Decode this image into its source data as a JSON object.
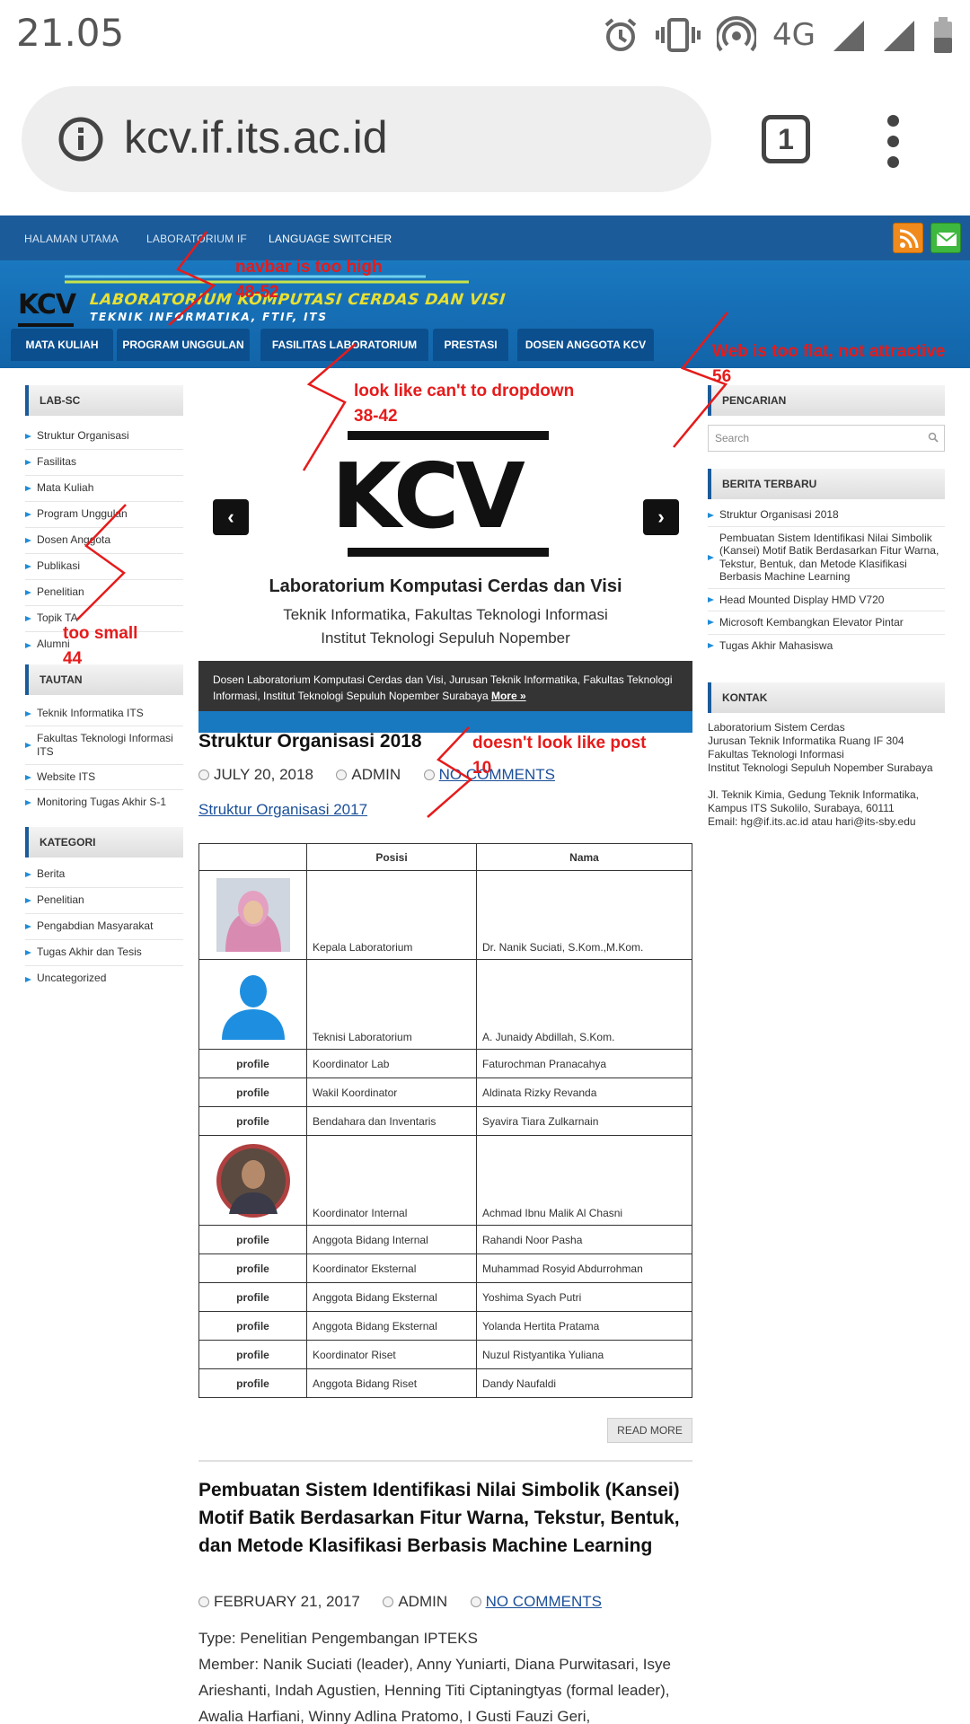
{
  "status_bar": {
    "time": "21.05",
    "network": "4G"
  },
  "browser": {
    "url": "kcv.if.its.ac.id",
    "tab_count": "1"
  },
  "top_nav": [
    "HALAMAN UTAMA",
    "LABORATORIUM IF",
    "LANGUAGE SWITCHER"
  ],
  "header": {
    "logo": "KCV",
    "title": "LABORATORIUM KOMPUTASI CERDAS DAN VISI",
    "subtitle": "TEKNIK INFORMATIKA, FTIF, ITS"
  },
  "main_nav": [
    "MATA KULIAH",
    "PROGRAM UNGGULAN",
    "FASILITAS LABORATORIUM",
    "PRESTASI",
    "DOSEN ANGGOTA KCV"
  ],
  "left_sidebar": {
    "lab_sc": {
      "title": "LAB-SC",
      "items": [
        "Struktur Organisasi",
        "Fasilitas",
        "Mata Kuliah",
        "Program Unggulan",
        "Dosen Anggota",
        "Publikasi",
        "Penelitian",
        "Topik TA",
        "Alumni"
      ]
    },
    "tautan": {
      "title": "TAUTAN",
      "items": [
        "Teknik Informatika ITS",
        "Fakultas Teknologi Informasi ITS",
        "Website ITS",
        "Monitoring Tugas Akhir S-1"
      ]
    },
    "kategori": {
      "title": "KATEGORI",
      "items": [
        "Berita",
        "Penelitian",
        "Pengabdian Masyarakat",
        "Tugas Akhir dan Tesis",
        "Uncategorized"
      ]
    }
  },
  "right_sidebar": {
    "search": {
      "title": "PENCARIAN",
      "placeholder": "Search"
    },
    "news": {
      "title": "BERITA TERBARU",
      "items": [
        "Struktur Organisasi 2018",
        "Pembuatan Sistem Identifikasi Nilai Simbolik (Kansei) Motif Batik Berdasarkan Fitur Warna, Tekstur, Bentuk, dan Metode Klasifikasi Berbasis Machine Learning",
        "Head Mounted Display HMD V720",
        "Microsoft Kembangkan Elevator Pintar",
        "Tugas Akhir Mahasiswa"
      ]
    },
    "contact": {
      "title": "KONTAK",
      "lines": [
        "Laboratorium Sistem Cerdas",
        "Jurusan Teknik Informatika Ruang IF 304",
        "Fakultas Teknologi Informasi",
        "Institut Teknologi Sepuluh Nopember Surabaya"
      ],
      "address": [
        "Jl. Teknik Kimia, Gedung Teknik Informatika,",
        "Kampus ITS Sukolilo, Surabaya, 60111",
        "Email: hg@if.its.ac.id atau hari@its-sby.edu"
      ]
    }
  },
  "slider": {
    "logo": "KCV",
    "line1": "Laboratorium Komputasi Cerdas dan Visi",
    "line2": "Teknik Informatika, Fakultas Teknologi Informasi",
    "line3": "Institut Teknologi Sepuluh Nopember",
    "caption": "Dosen Laboratorium Komputasi Cerdas dan Visi, Jurusan Teknik Informatika, Fakultas Teknologi Informasi, Institut Teknologi Sepuluh Nopember Surabaya",
    "caption_more": "More »",
    "prev": "‹",
    "next": "›"
  },
  "post1": {
    "title": "Struktur Organisasi 2018",
    "date": "JULY 20, 2018",
    "author": "ADMIN",
    "comments": "NO COMMENTS",
    "link": "Struktur Organisasi 2017",
    "table_headers": [
      "",
      "Posisi",
      "Nama"
    ],
    "rows": [
      {
        "photo": "female",
        "posisi": "Kepala Laboratorium",
        "nama": "Dr. Nanik Suciati, S.Kom.,M.Kom."
      },
      {
        "photo": "avatar",
        "posisi": "Teknisi Laboratorium",
        "nama": "A. Junaidy Abdillah, S.Kom."
      },
      {
        "photo": "profile",
        "posisi": "Koordinator Lab",
        "nama": "Faturochman Pranacahya"
      },
      {
        "photo": "profile",
        "posisi": "Wakil Koordinator",
        "nama": "Aldinata Rizky Revanda"
      },
      {
        "photo": "profile",
        "posisi": "Bendahara dan Inventaris",
        "nama": "Syavira Tiara Zulkarnain"
      },
      {
        "photo": "male",
        "posisi": "Koordinator Internal",
        "nama": "Achmad Ibnu Malik Al Chasni"
      },
      {
        "photo": "profile",
        "posisi": "Anggota Bidang Internal",
        "nama": "Rahandi Noor Pasha"
      },
      {
        "photo": "profile",
        "posisi": "Koordinator Eksternal",
        "nama": "Muhammad Rosyid Abdurrohman"
      },
      {
        "photo": "profile",
        "posisi": "Anggota Bidang Eksternal",
        "nama": "Yoshima Syach Putri"
      },
      {
        "photo": "profile",
        "posisi": "Anggota Bidang Eksternal",
        "nama": "Yolanda Hertita Pratama"
      },
      {
        "photo": "profile",
        "posisi": "Koordinator Riset",
        "nama": "Nuzul Ristyantika Yuliana"
      },
      {
        "photo": "profile",
        "posisi": "Anggota Bidang Riset",
        "nama": "Dandy Naufaldi"
      }
    ],
    "profile_alt": "profile",
    "read_more": "READ MORE"
  },
  "post2": {
    "title": "Pembuatan Sistem Identifikasi Nilai Simbolik (Kansei) Motif Batik Berdasarkan Fitur Warna, Tekstur, Bentuk, dan Metode Klasifikasi Berbasis Machine Learning",
    "date": "FEBRUARY 21, 2017",
    "author": "ADMIN",
    "comments": "NO COMMENTS",
    "type": "Type: Penelitian Pengembangan IPTEKS",
    "member": "Member: Nanik Suciati (leader), Anny Yuniarti, Diana Purwitasari, Isye Arieshanti, Indah Agustien, Henning Titi Ciptaningtyas (formal leader), Awalia Harfiani, Winny Adlina Pratomo, I Gusti Fauzi Geri,"
  },
  "annotations": [
    {
      "text": "navbar is too high",
      "score": "48-52"
    },
    {
      "text": "look like can't to dropdown",
      "score": "38-42"
    },
    {
      "text": "Web is too flat, not attractive",
      "score": "56"
    },
    {
      "text": "too small",
      "score": "44"
    },
    {
      "text": "doesn't look like post",
      "score": "10"
    }
  ],
  "colors": {
    "accent": "#1b5b99",
    "header": "#1a78c0",
    "annotation": "#e61b1b",
    "title_yellow": "#e8e032"
  }
}
